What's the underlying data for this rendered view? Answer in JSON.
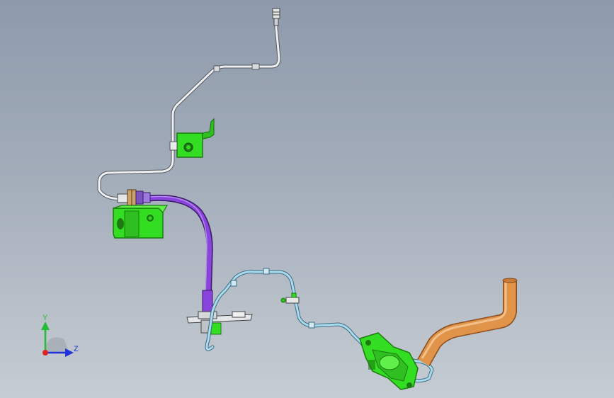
{
  "viewport": {
    "background_top": "#8e9aab",
    "background_bottom": "#c6ccd3"
  },
  "triad": {
    "y_label": "Y",
    "z_label": "Z",
    "colors": {
      "y": "#22bb33",
      "z": "#2233dd",
      "x": "#dd2222"
    }
  },
  "model": {
    "colors": {
      "bracket": "#33dd22",
      "bracket_edge": "#1d7a12",
      "tube_white": "#eef0f2",
      "tube_edge": "#555a60",
      "hose_purple": "#8844dd",
      "hose_edge": "#3a1a66",
      "tube_cyan": "#a9dcee",
      "tube_cyan_edge": "#3f6a80",
      "pipe_copper": "#e0944a",
      "pipe_copper_edge": "#8a4a1a"
    }
  }
}
